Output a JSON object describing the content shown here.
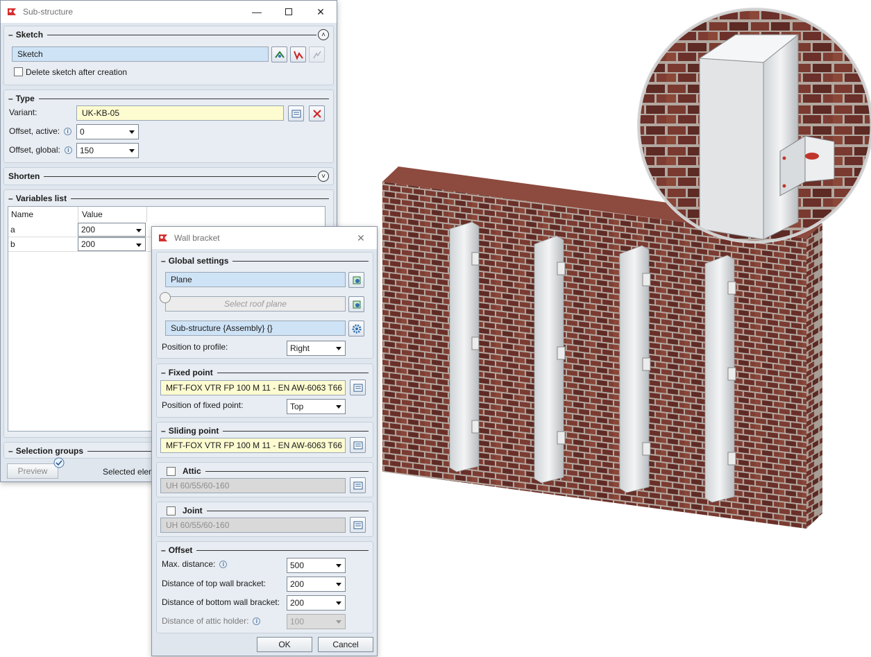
{
  "substructure": {
    "title": "Sub-structure",
    "sketch_section": {
      "title": "Sketch",
      "sketch_field": "Sketch",
      "delete_sketch_label": "Delete sketch after creation"
    },
    "type_section": {
      "title": "Type",
      "variant_label": "Variant:",
      "variant_value": "UK-KB-05",
      "offset_active_label": "Offset, active:",
      "offset_active_value": "0",
      "offset_global_label": "Offset, global:",
      "offset_global_value": "150"
    },
    "shorten_section": {
      "title": "Shorten"
    },
    "variables_section": {
      "title": "Variables list",
      "columns": [
        "Name",
        "Value"
      ],
      "rows": [
        {
          "name": "a",
          "value": "200"
        },
        {
          "name": "b",
          "value": "200"
        }
      ]
    },
    "selection_section": {
      "title": "Selection groups"
    },
    "preview_button": "Preview",
    "selected_text": "Selected elem"
  },
  "wall_bracket": {
    "title": "Wall bracket",
    "global_settings": {
      "title": "Global settings",
      "plane_field": "Plane",
      "roof_plane_placeholder": "Select roof plane",
      "assembly_field": "Sub-structure {Assembly} {}",
      "position_to_profile_label": "Position to profile:",
      "position_to_profile_value": "Right"
    },
    "fixed_point": {
      "title": "Fixed point",
      "value": "MFT-FOX VTR FP 100 M 11 - EN AW-6063 T66",
      "position_label": "Position of fixed point:",
      "position_value": "Top"
    },
    "sliding_point": {
      "title": "Sliding point",
      "value": "MFT-FOX VTR FP 100 M 11 - EN AW-6063 T66"
    },
    "attic": {
      "title": "Attic",
      "value": "UH 60/55/60-160"
    },
    "joint": {
      "title": "Joint",
      "value": "UH 60/55/60-160"
    },
    "offset": {
      "title": "Offset",
      "max_distance_label": "Max. distance:",
      "max_distance_value": "500",
      "top_distance_label": "Distance of top wall bracket:",
      "top_distance_value": "200",
      "bottom_distance_label": "Distance of bottom wall bracket:",
      "bottom_distance_value": "200",
      "attic_distance_label": "Distance of attic holder:",
      "attic_distance_value": "100"
    },
    "ok_button": "OK",
    "cancel_button": "Cancel"
  },
  "colors": {
    "brick": "#7a3a30",
    "mortar": "#b9b0a8",
    "panel_blue": "#cfe3f6",
    "field_yellow": "#fdfbd0",
    "dialog_bg": "#dfe6ee"
  }
}
